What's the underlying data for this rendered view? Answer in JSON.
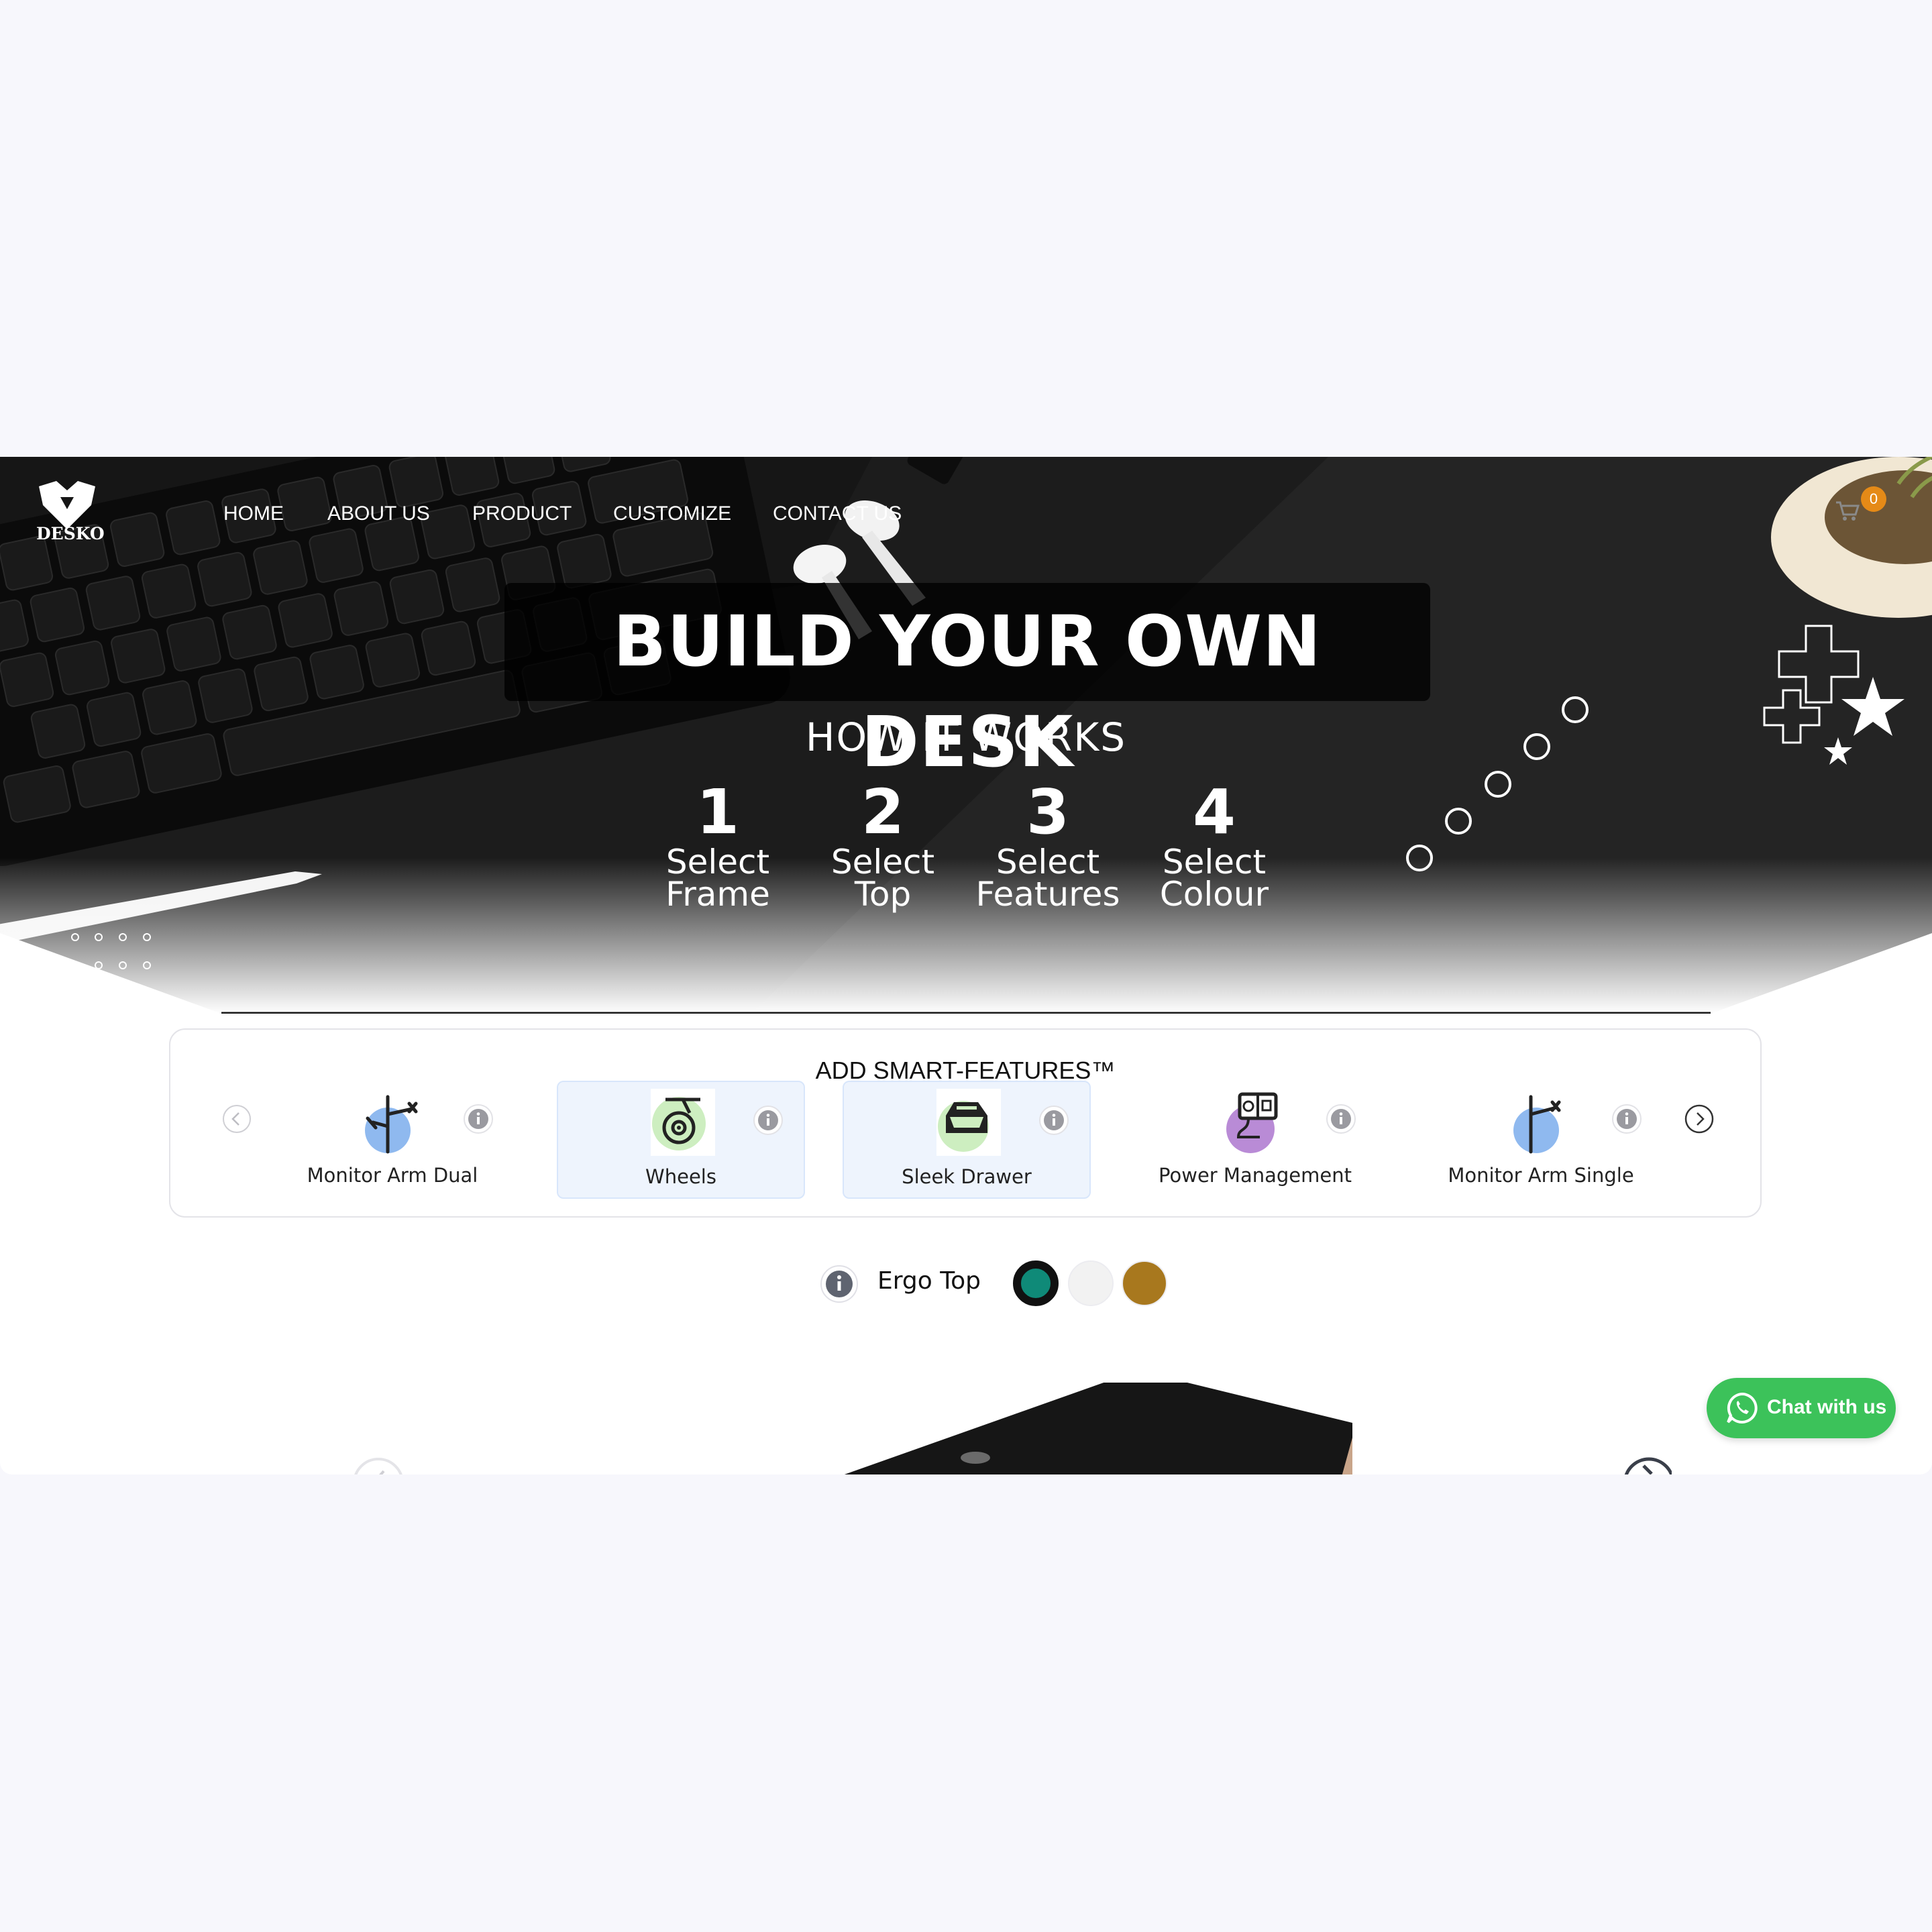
{
  "brand": {
    "name": "DESKO"
  },
  "nav": {
    "items": [
      {
        "label": "HOME"
      },
      {
        "label": "ABOUT US"
      },
      {
        "label": "PRODUCT"
      },
      {
        "label": "CUSTOMIZE"
      },
      {
        "label": "CONTACT US"
      }
    ]
  },
  "cart": {
    "icon": "cart-icon",
    "count": "0",
    "badge_color": "#e58a17"
  },
  "hero": {
    "title": "BUILD YOUR OWN DESK",
    "subtitle": "HOW IT WORKS",
    "steps": [
      {
        "number": "1",
        "line1": "Select",
        "line2": "Frame"
      },
      {
        "number": "2",
        "line1": "Select",
        "line2": "Top"
      },
      {
        "number": "3",
        "line1": "Select",
        "line2": "Features"
      },
      {
        "number": "4",
        "line1": "Select",
        "line2": "Colour"
      }
    ]
  },
  "features": {
    "title": "ADD SMART-FEATURES™",
    "items": [
      {
        "name": "Monitor Arm Dual",
        "icon": "monitor-arm-dual-icon",
        "selected": false
      },
      {
        "name": "Wheels",
        "icon": "wheels-icon",
        "selected": true
      },
      {
        "name": "Sleek Drawer",
        "icon": "drawer-icon",
        "selected": true
      },
      {
        "name": "Power Management",
        "icon": "power-management-icon",
        "selected": false
      },
      {
        "name": "Monitor Arm Single",
        "icon": "monitor-arm-single-icon",
        "selected": false
      }
    ]
  },
  "top": {
    "label": "Ergo Top",
    "colors": [
      "#0f8a78",
      "#f2f2f2",
      "#a8781e"
    ],
    "selected_color": "#0f8a78"
  },
  "chat": {
    "label": "Chat with us",
    "color": "#3cc25a"
  }
}
